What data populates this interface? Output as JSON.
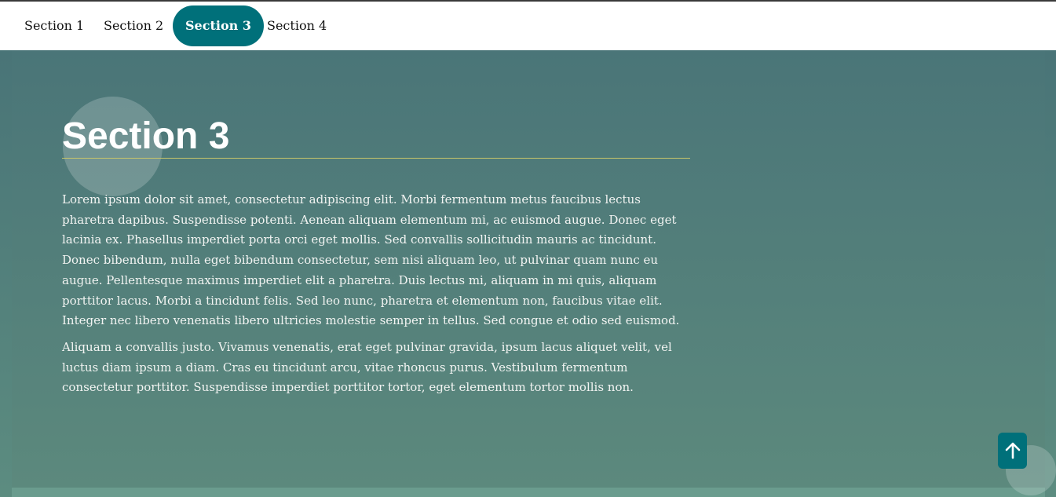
{
  "nav": {
    "items": [
      {
        "label": "Section 1"
      },
      {
        "label": "Section 2"
      },
      {
        "label": "Section 3",
        "active": true
      },
      {
        "label": "Section 4"
      }
    ],
    "active_color": "#00707a"
  },
  "section": {
    "title": "Section 3",
    "paragraphs": [
      "Lorem ipsum dolor sit amet, consectetur adipiscing elit. Morbi fermentum metus faucibus lectus pharetra dapibus. Suspendisse potenti. Aenean aliquam elementum mi, ac euismod augue. Donec eget lacinia ex. Phasellus imperdiet porta orci eget mollis. Sed convallis sollicitudin mauris ac tincidunt. Donec bibendum, nulla eget bibendum consectetur, sem nisi aliquam leo, ut pulvinar quam nunc eu augue. Pellentesque maximus imperdiet elit a pharetra. Duis lectus mi, aliquam in mi quis, aliquam porttitor lacus. Morbi a tincidunt felis. Sed leo nunc, pharetra et elementum non, faucibus vitae elit. Integer nec libero venenatis libero ultricies molestie semper in tellus. Sed congue et odio sed euismod.",
      "Aliquam a convallis justo. Vivamus venenatis, erat eget pulvinar gravida, ipsum lacus aliquet velit, vel luctus diam ipsum a diam. Cras eu tincidunt arcu, vitae rhoncus purus. Vestibulum fermentum consectetur porttitor. Suspendisse imperdiet porttitor tortor, eget elementum tortor mollis non."
    ]
  },
  "scroll_top": {
    "icon": "arrow-up-icon"
  }
}
